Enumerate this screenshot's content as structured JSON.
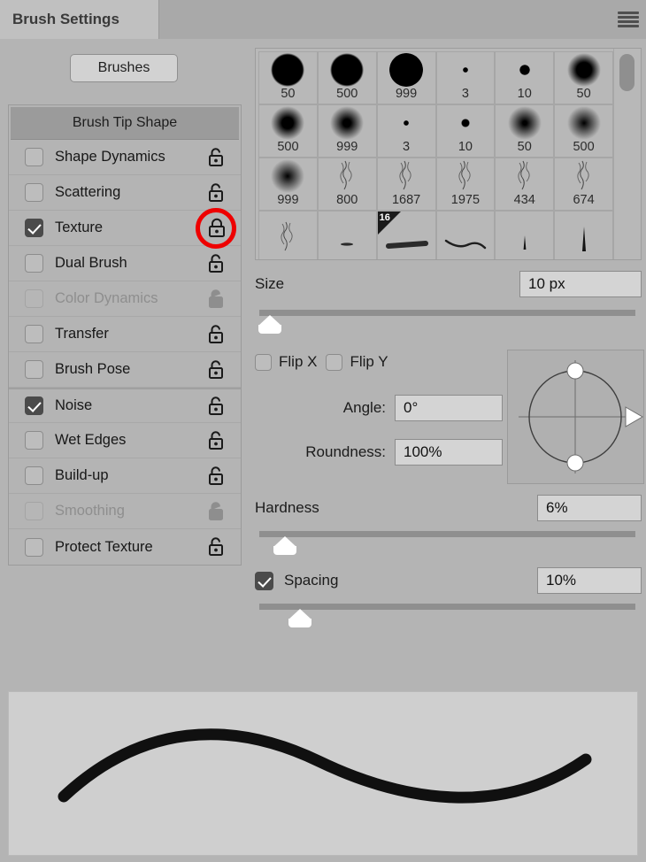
{
  "window": {
    "active_tab": "Brush Settings",
    "menu_icon": "hamburger-menu-icon"
  },
  "left_panel": {
    "brushes_button": "Brushes",
    "section_header": "Brush Tip Shape",
    "options": [
      {
        "label": "Shape Dynamics",
        "checked": false,
        "disabled": false,
        "lock": "unlocked",
        "highlighted": false
      },
      {
        "label": "Scattering",
        "checked": false,
        "disabled": false,
        "lock": "unlocked",
        "highlighted": false
      },
      {
        "label": "Texture",
        "checked": true,
        "disabled": false,
        "lock": "locked",
        "highlighted": true
      },
      {
        "label": "Dual Brush",
        "checked": false,
        "disabled": false,
        "lock": "unlocked",
        "highlighted": false
      },
      {
        "label": "Color Dynamics",
        "checked": false,
        "disabled": true,
        "lock": "unlocked",
        "highlighted": false
      },
      {
        "label": "Transfer",
        "checked": false,
        "disabled": false,
        "lock": "unlocked",
        "highlighted": false
      },
      {
        "label": "Brush Pose",
        "checked": false,
        "disabled": false,
        "lock": "unlocked",
        "highlighted": false
      },
      {
        "label": "Noise",
        "checked": true,
        "disabled": false,
        "lock": "unlocked",
        "highlighted": false
      },
      {
        "label": "Wet Edges",
        "checked": false,
        "disabled": false,
        "lock": "unlocked",
        "highlighted": false
      },
      {
        "label": "Build-up",
        "checked": false,
        "disabled": false,
        "lock": "unlocked",
        "highlighted": false
      },
      {
        "label": "Smoothing",
        "checked": false,
        "disabled": true,
        "lock": "unlocked",
        "highlighted": false
      },
      {
        "label": "Protect Texture",
        "checked": false,
        "disabled": false,
        "lock": "unlocked",
        "highlighted": false
      }
    ]
  },
  "brush_grid": {
    "selected_index": 20,
    "selected_badge": "16",
    "presets": [
      {
        "label": "50",
        "type": "hard-round",
        "size": 30,
        "blur": 1
      },
      {
        "label": "500",
        "type": "hard-round",
        "size": 30,
        "blur": 1
      },
      {
        "label": "999",
        "type": "hard-round",
        "size": 30,
        "blur": 0
      },
      {
        "label": "3",
        "type": "soft-round",
        "size": 3,
        "blur": 1
      },
      {
        "label": "10",
        "type": "soft-round",
        "size": 6,
        "blur": 1
      },
      {
        "label": "50",
        "type": "soft-round",
        "size": 26,
        "blur": 5
      },
      {
        "label": "500",
        "type": "soft-round",
        "size": 26,
        "blur": 6
      },
      {
        "label": "999",
        "type": "soft-round",
        "size": 26,
        "blur": 7
      },
      {
        "label": "3",
        "type": "soft-round",
        "size": 3,
        "blur": 1
      },
      {
        "label": "10",
        "type": "soft-round",
        "size": 5,
        "blur": 2
      },
      {
        "label": "50",
        "type": "soft-round",
        "size": 22,
        "blur": 8
      },
      {
        "label": "500",
        "type": "soft-round",
        "size": 22,
        "blur": 9
      },
      {
        "label": "999",
        "type": "soft-round",
        "size": 26,
        "blur": 9
      },
      {
        "label": "800",
        "type": "bristle",
        "size": 0,
        "blur": 0
      },
      {
        "label": "1687",
        "type": "bristle",
        "size": 0,
        "blur": 0
      },
      {
        "label": "1975",
        "type": "bristle",
        "size": 0,
        "blur": 0
      },
      {
        "label": "434",
        "type": "bristle",
        "size": 0,
        "blur": 0
      },
      {
        "label": "674",
        "type": "bristle",
        "size": 0,
        "blur": 0
      },
      {
        "label": "",
        "type": "bristle",
        "size": 0,
        "blur": 0
      },
      {
        "label": "",
        "type": "stroke-thin",
        "size": 0,
        "blur": 0
      },
      {
        "label": "",
        "type": "stroke-flat",
        "size": 0,
        "blur": 0
      },
      {
        "label": "",
        "type": "stroke-wave",
        "size": 0,
        "blur": 0
      },
      {
        "label": "",
        "type": "stroke-tip",
        "size": 0,
        "blur": 0
      },
      {
        "label": "",
        "type": "stroke-tall",
        "size": 0,
        "blur": 0
      }
    ]
  },
  "controls": {
    "size": {
      "label": "Size",
      "value": "10 px",
      "slider_percent": 2
    },
    "flip_x": {
      "label": "Flip X",
      "checked": false
    },
    "flip_y": {
      "label": "Flip Y",
      "checked": false
    },
    "angle": {
      "label": "Angle:",
      "value": "0°"
    },
    "roundness": {
      "label": "Roundness:",
      "value": "100%"
    },
    "hardness": {
      "label": "Hardness",
      "value": "6%",
      "slider_percent": 6
    },
    "spacing": {
      "label": "Spacing",
      "value": "10%",
      "checked": true,
      "slider_percent": 10
    }
  },
  "angle_widget": {
    "name": "angle-roundness-preview",
    "angle_degrees": 0,
    "roundness_percent": 100
  },
  "stroke_preview": {
    "name": "brush-stroke-preview"
  },
  "colors": {
    "panel_bg": "#b4b4b4",
    "tab_active_bg": "#c0c0c0",
    "header_bg": "#9b9b9b",
    "field_bg": "#d4d4d4",
    "annotation_red": "#ee0000",
    "checkbox_on": "#4b4b4b"
  }
}
